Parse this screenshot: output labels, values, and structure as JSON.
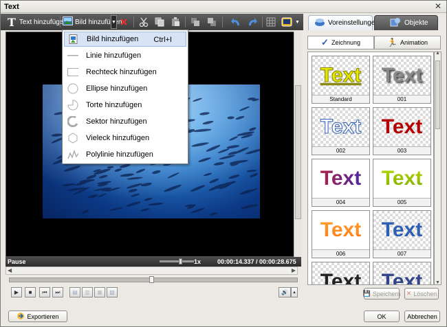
{
  "window": {
    "title": "Text",
    "close_glyph": "✕"
  },
  "toolbar": {
    "add_text_label": "Text hinzufügen",
    "add_image_label": "Bild hinzufügen"
  },
  "tabs": {
    "presets": "Voreinstellungen",
    "objects": "Objekte"
  },
  "subtabs": {
    "drawing": "Zeichnung",
    "animation": "Animation"
  },
  "menu": {
    "items": [
      {
        "label": "Bild hinzufügen",
        "shortcut": "Ctrl+I",
        "icon": "image-icon",
        "highlighted": true
      },
      {
        "label": "Linie hinzufügen",
        "shortcut": "",
        "icon": "line-icon"
      },
      {
        "label": "Rechteck hinzufügen",
        "shortcut": "",
        "icon": "rectangle-icon"
      },
      {
        "label": "Ellipse hinzufügen",
        "shortcut": "",
        "icon": "ellipse-icon"
      },
      {
        "label": "Torte hinzufügen",
        "shortcut": "",
        "icon": "pie-icon"
      },
      {
        "label": "Sektor hinzufügen",
        "shortcut": "",
        "icon": "sector-icon"
      },
      {
        "label": "Vieleck hinzufügen",
        "shortcut": "",
        "icon": "polygon-icon"
      },
      {
        "label": "Polylinie hinzufügen",
        "shortcut": "",
        "icon": "polyline-icon"
      }
    ]
  },
  "status": {
    "state": "Pause",
    "speed": "1x",
    "time": "00:00:14.337 / 00:00:28.675"
  },
  "presets": [
    {
      "sample": "Text",
      "caption": "Standard",
      "color": "#e7e800",
      "style": "outline"
    },
    {
      "sample": "Text",
      "caption": "001",
      "color": "#8a8a8a",
      "style": "shadow"
    },
    {
      "sample": "Text",
      "caption": "002",
      "color": "#ffffff",
      "style": "blue-outline"
    },
    {
      "sample": "Text",
      "caption": "003",
      "color": "#b40000",
      "style": "plain"
    },
    {
      "sample": "Text",
      "caption": "004",
      "color": "#b0205a",
      "style": "gradient-blue"
    },
    {
      "sample": "Text",
      "caption": "005",
      "color": "#a6d400",
      "style": "gradient-green"
    },
    {
      "sample": "Text",
      "caption": "006",
      "color": "#ff8a1c",
      "style": "gradient-orange"
    },
    {
      "sample": "Text",
      "caption": "007",
      "color": "#2f5fb3",
      "style": "plain"
    },
    {
      "sample": "Text",
      "caption": "",
      "color": "#222222",
      "style": "plain"
    },
    {
      "sample": "Text",
      "caption": "",
      "color": "#334488",
      "style": "plain"
    }
  ],
  "buttons": {
    "save": "Speichern",
    "delete": "Löschen",
    "export": "Exportieren",
    "ok": "OK",
    "cancel": "Abbrechen"
  },
  "colors": {
    "toolbar": "#4a4a4a",
    "accent": "#2a78c8"
  }
}
